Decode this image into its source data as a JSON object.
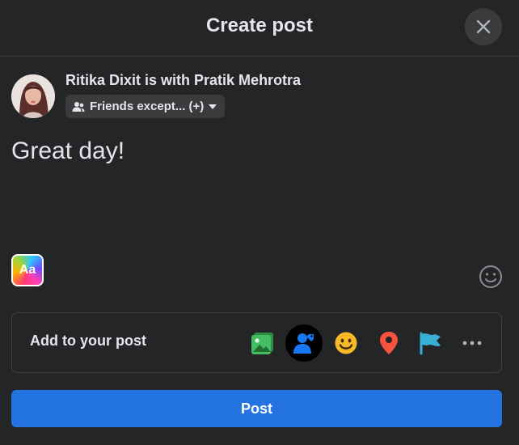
{
  "header": {
    "title": "Create post"
  },
  "icons": {
    "close": "close-icon",
    "privacy": "friends-icon",
    "dropdown": "caret-down-icon",
    "text_background": "text-background-icon",
    "emoji": "emoji-icon"
  },
  "user": {
    "line": "Ritika Dixit is with Pratik Mehrotra",
    "privacy_label": "Friends except... (+)"
  },
  "composer": {
    "text": "Great day!",
    "text_bg_label": "Aa"
  },
  "add_to_post": {
    "label": "Add to your post",
    "items": [
      {
        "icon": "photo-video-icon",
        "color": "#45bd62"
      },
      {
        "icon": "tag-people-icon",
        "color": "#1877f2"
      },
      {
        "icon": "feeling-icon",
        "color": "#f7b928"
      },
      {
        "icon": "check-in-icon",
        "color": "#f5533d"
      },
      {
        "icon": "life-event-icon",
        "color": "#39afd5"
      },
      {
        "icon": "more-icon",
        "color": "#b0b3b8"
      }
    ]
  },
  "actions": {
    "post_label": "Post"
  },
  "colors": {
    "background": "#242526",
    "surface": "#3a3b3c",
    "primary": "#2374e1",
    "text": "#e4e6eb"
  }
}
